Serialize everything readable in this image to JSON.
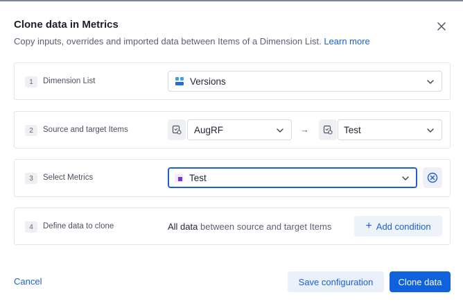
{
  "dialog": {
    "title": "Clone data in Metrics",
    "subtitle": "Copy inputs, overrides and imported data between Items of a Dimension List.",
    "learn_more": "Learn more",
    "close_icon": "close-icon"
  },
  "steps": [
    {
      "number": "1",
      "label": "Dimension List",
      "value": "Versions",
      "icon": "versions-grid-icon"
    },
    {
      "number": "2",
      "label": "Source and target Items",
      "source": "AugRF",
      "arrow": "→",
      "target": "Test",
      "icon": "item-settings-icon"
    },
    {
      "number": "3",
      "label": "Select Metrics",
      "value": "Test",
      "icon": "metric-icon",
      "clear_icon": "clear-circle-icon"
    },
    {
      "number": "4",
      "label": "Define data to clone",
      "summary_strong": "All data",
      "summary_rest": "between source and target Items",
      "add_condition": "Add condition"
    }
  ],
  "footer": {
    "cancel": "Cancel",
    "save": "Save configuration",
    "clone": "Clone data"
  },
  "colors": {
    "accent": "#0f62dc",
    "link": "#1b5fd6",
    "focus_border": "#1b5fd6",
    "metric_icon": "#7b2fd6"
  }
}
